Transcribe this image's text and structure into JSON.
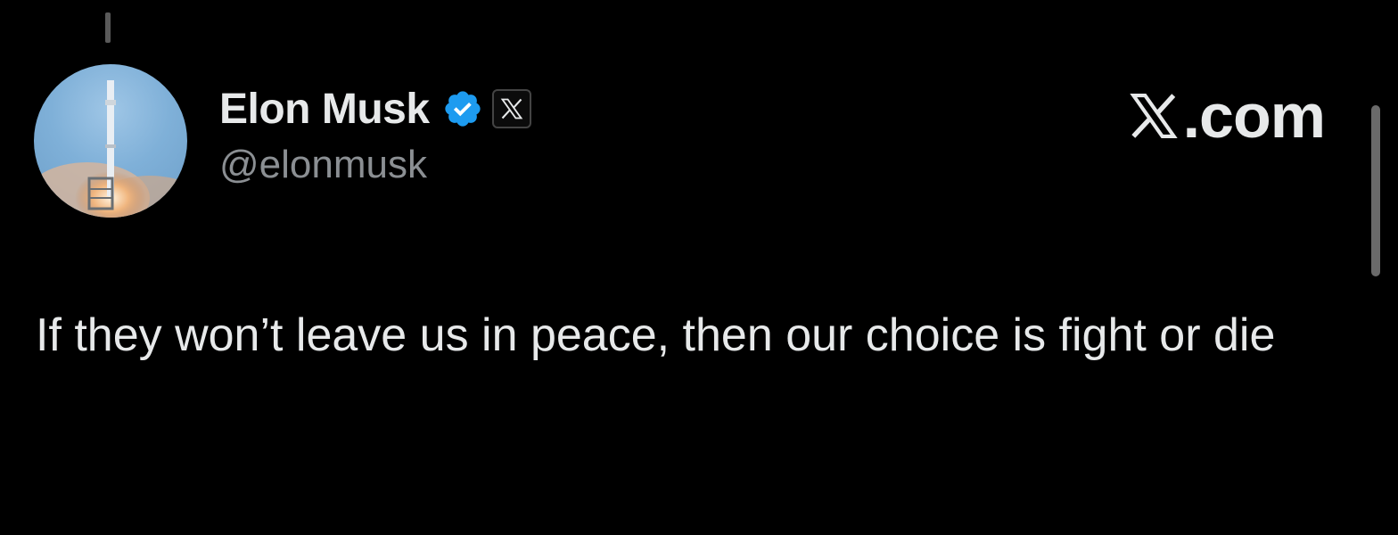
{
  "post": {
    "author": {
      "display_name": "Elon Musk",
      "handle": "@elonmusk",
      "avatar_icon": "rocket-launch-avatar",
      "badges": [
        "verified-badge-icon",
        "x-affiliate-icon"
      ]
    },
    "text": "If they won’t leave us in peace, then our choice is fight or die"
  },
  "watermark": {
    "brand": ".com",
    "brand_icon": "x-logo-icon"
  },
  "colors": {
    "background": "#000000",
    "text_primary": "#e7e9ea",
    "text_secondary": "#8b8f93",
    "verified_blue": "#1d9bf0"
  }
}
